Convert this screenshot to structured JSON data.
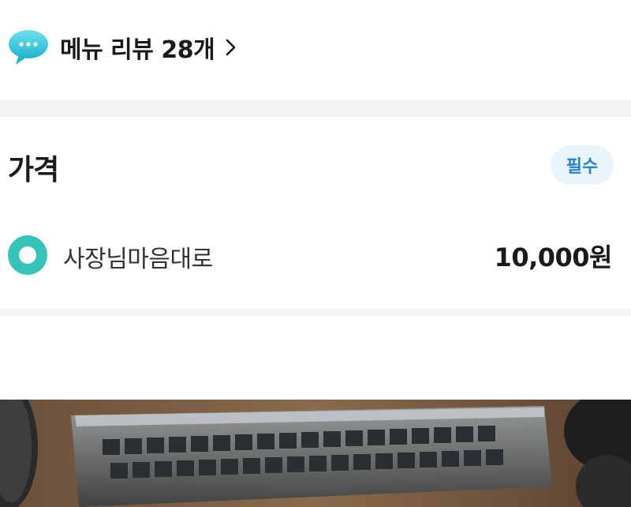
{
  "review": {
    "icon": "speech-bubble-icon",
    "label": "메뉴 리뷰",
    "count": "28개",
    "chevron_icon": "chevron-right-icon"
  },
  "price_section": {
    "title": "가격",
    "required_badge": "필수",
    "options": [
      {
        "label": "사장님마음대로",
        "price": "10,000원",
        "selected": true
      }
    ]
  },
  "photo": {
    "description_icon": "product-photo"
  },
  "colors": {
    "accent": "#36c3b9",
    "badge_bg": "#eaf4fc",
    "badge_text": "#2b82c6",
    "divider": "#f4f5f7"
  }
}
